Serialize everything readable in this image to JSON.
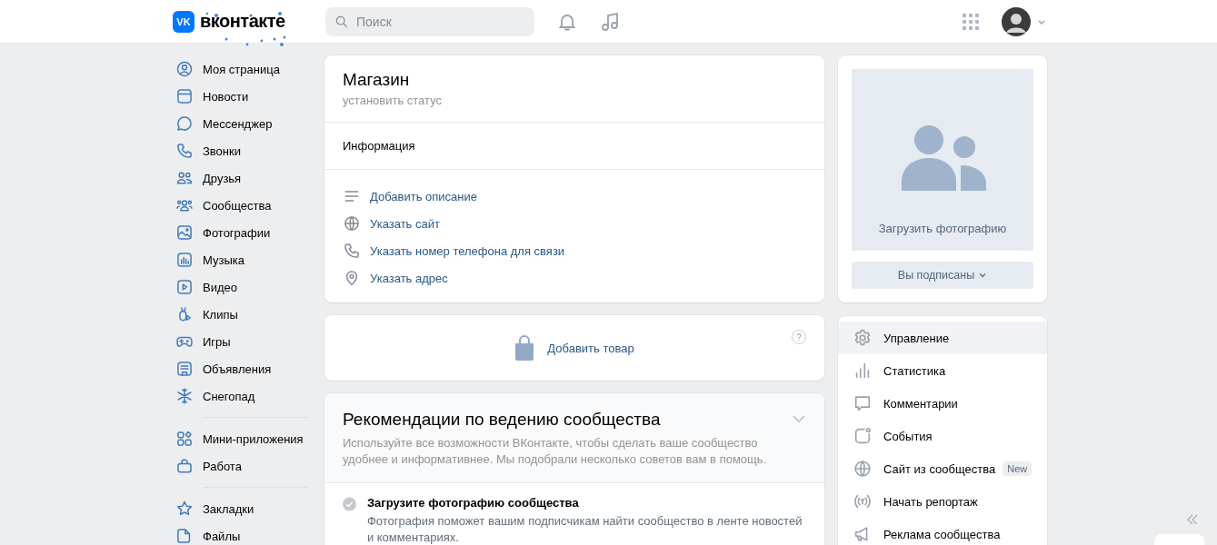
{
  "header": {
    "logo": {
      "mark": "VK",
      "name": "вконтакте"
    },
    "search": {
      "placeholder": "Поиск"
    }
  },
  "sidebar": {
    "groups": [
      [
        {
          "label": "Моя страница"
        },
        {
          "label": "Новости"
        },
        {
          "label": "Мессенджер"
        },
        {
          "label": "Звонки"
        },
        {
          "label": "Друзья"
        },
        {
          "label": "Сообщества"
        },
        {
          "label": "Фотографии"
        },
        {
          "label": "Музыка"
        },
        {
          "label": "Видео"
        },
        {
          "label": "Клипы"
        },
        {
          "label": "Игры"
        },
        {
          "label": "Объявления"
        },
        {
          "label": "Снегопад"
        }
      ],
      [
        {
          "label": "Мини-приложения"
        },
        {
          "label": "Работа"
        }
      ],
      [
        {
          "label": "Закладки"
        },
        {
          "label": "Файлы"
        }
      ]
    ]
  },
  "profile": {
    "title": "Магазин",
    "status": "установить статус",
    "section": "Информация",
    "links": [
      {
        "label": "Добавить описание"
      },
      {
        "label": "Указать сайт"
      },
      {
        "label": "Указать номер телефона для связи"
      },
      {
        "label": "Указать адрес"
      }
    ]
  },
  "products": {
    "action": "Добавить товар",
    "help": "?"
  },
  "recommendations": {
    "title": "Рекомендации по ведению сообщества",
    "description": "Используйте все возможности ВКонтакте, чтобы сделать ваше сообщество удобнее и информативнее. Мы подобрали несколько советов вам в помощь.",
    "items": [
      {
        "title": "Загрузите фотографию сообщества",
        "text": "Фотография поможет вашим подписчикам найти сообщество в ленте новостей и комментариях.",
        "done": false
      }
    ]
  },
  "photo": {
    "caption": "Загрузить фотографию",
    "button": "Вы подписаны"
  },
  "menu": [
    {
      "label": "Управление",
      "selected": true
    },
    {
      "label": "Статистика",
      "selected": false
    },
    {
      "label": "Комментарии",
      "selected": false
    },
    {
      "label": "События",
      "selected": false
    },
    {
      "label": "Сайт из сообщества",
      "selected": false,
      "badge": "New"
    },
    {
      "label": "Начать репортаж",
      "selected": false
    },
    {
      "label": "Реклама сообщества",
      "selected": false
    }
  ]
}
